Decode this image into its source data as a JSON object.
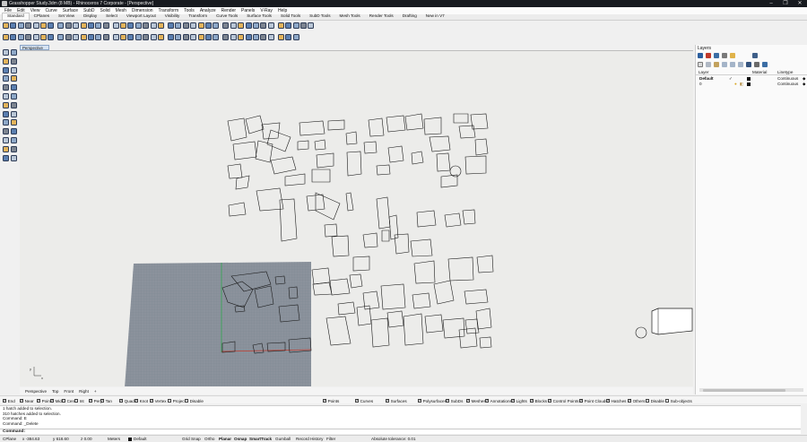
{
  "window": {
    "title": "Grasshopper Study.3dm (8 MB) - Rhinoceros 7 Corporate - [Perspective]",
    "controls": [
      "–",
      "❐",
      "✕"
    ]
  },
  "menu": [
    "File",
    "Edit",
    "View",
    "Curve",
    "Surface",
    "SubD",
    "Solid",
    "Mesh",
    "Dimension",
    "Transform",
    "Tools",
    "Analyze",
    "Render",
    "Panels",
    "V-Ray",
    "Help"
  ],
  "toolbar_tabs": [
    "Standard",
    "CPlanes",
    "Set View",
    "Display",
    "Select",
    "Viewport Layout",
    "Visibility",
    "Transform",
    "Curve Tools",
    "Surface Tools",
    "Solid Tools",
    "SubD Tools",
    "Mesh Tools",
    "Render Tools",
    "Drafting",
    "New in V7"
  ],
  "viewport": {
    "active_tab": "Perspective",
    "bottom_tabs": [
      "Perspective",
      "Top",
      "Front",
      "Right",
      "+"
    ],
    "axis_labels": {
      "x": "x",
      "y": "y"
    }
  },
  "layers_panel": {
    "title": "Layers",
    "columns": {
      "layer": "Layer",
      "material": "Material",
      "linetype": "Linetype"
    },
    "rows": [
      {
        "name": "Default",
        "check": "✓",
        "linetype": "Continuous"
      },
      {
        "name": "0",
        "check": "",
        "linetype": "Continuous"
      }
    ]
  },
  "osnaps": [
    {
      "label": "End",
      "on": true
    },
    {
      "label": "Near",
      "on": true
    },
    {
      "label": "Point",
      "on": true
    },
    {
      "label": "Mid",
      "on": true
    },
    {
      "label": "Cen",
      "on": false
    },
    {
      "label": "Int",
      "on": false
    },
    {
      "label": "Perp",
      "on": true
    },
    {
      "label": "Tan",
      "on": true
    },
    {
      "label": "Quad",
      "on": true
    },
    {
      "label": "Knot",
      "on": true
    },
    {
      "label": "Vertex",
      "on": true
    },
    {
      "label": "Project",
      "on": false
    },
    {
      "label": "Disable",
      "on": false
    }
  ],
  "selection_filters": [
    {
      "label": "Points",
      "on": true
    },
    {
      "label": "Curves",
      "on": true
    },
    {
      "label": "Surfaces",
      "on": true
    },
    {
      "label": "Polysurfaces",
      "on": true
    },
    {
      "label": "SubDs",
      "on": true
    },
    {
      "label": "Meshes",
      "on": true
    },
    {
      "label": "Annotations",
      "on": true
    },
    {
      "label": "Lights",
      "on": true
    },
    {
      "label": "Blocks",
      "on": true
    },
    {
      "label": "Control Points",
      "on": true
    },
    {
      "label": "Point Clouds",
      "on": true
    },
    {
      "label": "Hatches",
      "on": true
    },
    {
      "label": "Others",
      "on": true
    },
    {
      "label": "Disable",
      "on": false
    },
    {
      "label": "Sub-objects",
      "on": false
    }
  ],
  "command_history": [
    "1 hatch added to selection.",
    "310 hatches added to selection.",
    "Command: E",
    "Command: _Delete"
  ],
  "command_prompt": "Command:",
  "status": {
    "cplane": "CPlane",
    "x": "x -384.63",
    "y": "y 618.60",
    "z": "z 0.00",
    "units": "Meters",
    "layer": "Default",
    "toggles": [
      {
        "label": "Grid Snap",
        "bold": false
      },
      {
        "label": "Ortho",
        "bold": false
      },
      {
        "label": "Planar",
        "bold": true
      },
      {
        "label": "Osnap",
        "bold": true
      },
      {
        "label": "SmartTrack",
        "bold": true
      },
      {
        "label": "Gumball",
        "bold": false
      },
      {
        "label": "Record History",
        "bold": false
      },
      {
        "label": "Filter",
        "bold": false
      }
    ],
    "tolerance": "Absolute tolerance: 0.01"
  },
  "colors": {
    "viewport_bg": "#ececea",
    "grid_plane": "#8b929c",
    "grid_line": "#7b838e",
    "y_axis": "#2fa84f",
    "x_axis": "#c0392b",
    "titlebar": "#171a1f"
  }
}
